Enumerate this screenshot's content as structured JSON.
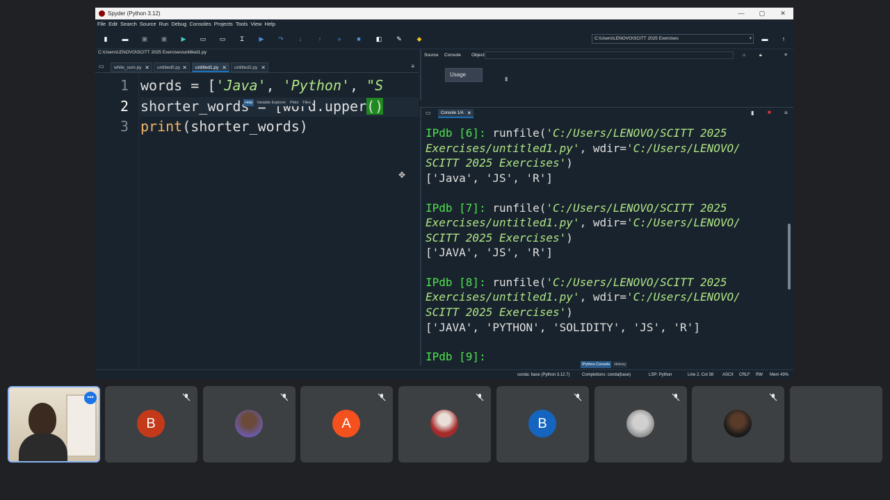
{
  "window": {
    "title": "Spyder (Python 3.12)",
    "controls": [
      "—",
      "▢",
      "✕"
    ]
  },
  "menu": [
    "File",
    "Edit",
    "Search",
    "Source",
    "Run",
    "Debug",
    "Consoles",
    "Projects",
    "Tools",
    "View",
    "Help"
  ],
  "toolbar": {
    "working_dir": "C:\\Users\\LENOVO\\SCITT 2025 Exercises",
    "icons": [
      "new-file-icon",
      "open-folder-icon",
      "save-icon",
      "save-all-icon",
      "run-icon",
      "run-cell-icon",
      "run-cell-advance-icon",
      "run-selection-icon",
      "debug-icon",
      "step-icon",
      "step-into-icon",
      "step-return-icon",
      "continue-icon",
      "stop-icon",
      "maximize-pane-icon",
      "preferences-icon",
      "python-path-icon"
    ]
  },
  "editor": {
    "path": "C:\\Users\\LENOVO\\SCITT 2025 Exercises\\untitled1.py",
    "tabs": [
      {
        "label": "while_sum.py"
      },
      {
        "label": "untitled0.py"
      },
      {
        "label": "untitled1.py"
      },
      {
        "label": "untitled2.py"
      }
    ],
    "line_numbers": [
      "1",
      "2",
      "3"
    ],
    "lines": {
      "l1_a": "words = [",
      "l1_s1": "'Java'",
      "l1_b": ", ",
      "l1_s2": "'Python'",
      "l1_c": ", ",
      "l1_s3": "\"S",
      "l2_a": "shorter_words = [word.upper",
      "l2_b": "()",
      "l3_a": "print",
      "l3_b": "(shorter_words)"
    }
  },
  "help_pane": {
    "source_label": "Source",
    "console_label": "Console",
    "object_label": "Object",
    "usage_button": "Usage",
    "tabs": [
      "Help",
      "Variable Explorer",
      "Plots",
      "Files"
    ]
  },
  "console": {
    "tab": "Console 1/A",
    "blocks": [
      {
        "prompt": "IPdb [6]:",
        "cmd": " runfile(",
        "s1": "'C:/Users/LENOVO/SCITT 2025",
        "s2": "Exercises/untitled1.py'",
        "mid": ", wdir=",
        "s3": "'C:/Users/LENOVO/",
        "s4": "SCITT 2025 Exercises'",
        "close": ")",
        "output": "['Java', 'JS', 'R']"
      },
      {
        "prompt": "IPdb [7]:",
        "cmd": " runfile(",
        "s1": "'C:/Users/LENOVO/SCITT 2025",
        "s2": "Exercises/untitled1.py'",
        "mid": ", wdir=",
        "s3": "'C:/Users/LENOVO/",
        "s4": "SCITT 2025 Exercises'",
        "close": ")",
        "output": "['JAVA', 'JS', 'R']"
      },
      {
        "prompt": "IPdb [8]:",
        "cmd": " runfile(",
        "s1": "'C:/Users/LENOVO/SCITT 2025",
        "s2": "Exercises/untitled1.py'",
        "mid": ", wdir=",
        "s3": "'C:/Users/LENOVO/",
        "s4": "SCITT 2025 Exercises'",
        "close": ")",
        "output": "['JAVA', 'PYTHON', 'SOLIDITY', 'JS', 'R']"
      }
    ],
    "last_prompt": "IPdb [9]:",
    "bottom_tabs": [
      "IPython Console",
      "History"
    ]
  },
  "status": {
    "conda": "conda: base (Python 3.12.7)",
    "completions": "Completions: conda(base)",
    "lsp": "LSP: Python",
    "position": "Line 2, Col 38",
    "encoding": "ASCII",
    "eol": "CRLF",
    "rw": "RW",
    "mem": "Mem 43%"
  },
  "participants": [
    {
      "initial": "",
      "color": "#d9cdb9"
    },
    {
      "initial": "B",
      "color": "#c5391b"
    },
    {
      "initial": "",
      "color": "#6b5aa8"
    },
    {
      "initial": "A",
      "color": "#f4511e"
    },
    {
      "initial": "",
      "color": "#a52a2a"
    },
    {
      "initial": "B",
      "color": "#1565c0"
    },
    {
      "initial": "",
      "color": "#9e9e9e"
    },
    {
      "initial": "",
      "color": "#1a1a1a"
    },
    {
      "initial": "",
      "color": "#3c4043"
    }
  ]
}
